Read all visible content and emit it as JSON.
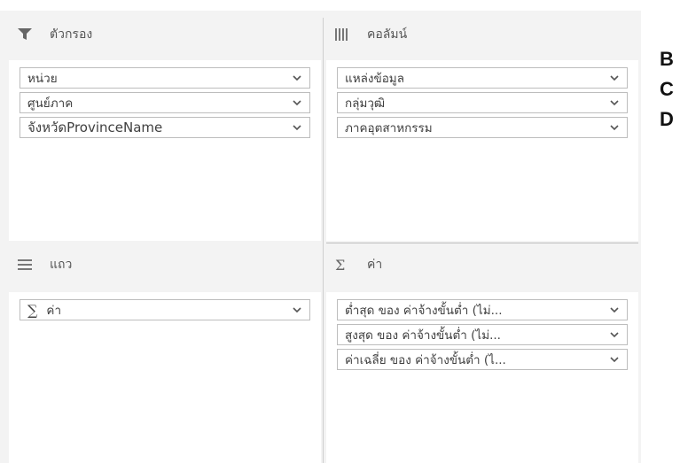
{
  "filters": {
    "title": "ตัวกรอง",
    "icon": "filter-icon",
    "fields": [
      "หน่วย",
      "ศูนย์ภาค",
      "จังหวัดProvinceName"
    ]
  },
  "columns": {
    "title": "คอลัมน์",
    "icon": "columns-icon",
    "fields": [
      "แหล่งข้อมูล",
      "กลุ่มวุฒิ",
      "ภาคอุตสาหกรรม"
    ]
  },
  "rows": {
    "title": "แถว",
    "icon": "rows-icon",
    "fields": [
      "ค่า"
    ]
  },
  "values": {
    "title": "ค่า",
    "icon": "sigma-icon",
    "fields": [
      "ต่ำสุด ของ ค่าจ้างขั้นต่ำ (ไม่...",
      "สูงสุด ของ ค่าจ้างขั้นต่ำ (ไม่...",
      "ค่าเฉลี่ย ของ ค่าจ้างขั้นต่ำ (ไ..."
    ]
  },
  "side_letters": [
    "B",
    "C",
    "D"
  ],
  "colors": {
    "panel_bg": "#f3f3f3",
    "field_border": "#bdbdbd",
    "text": "#3f3f3f"
  }
}
